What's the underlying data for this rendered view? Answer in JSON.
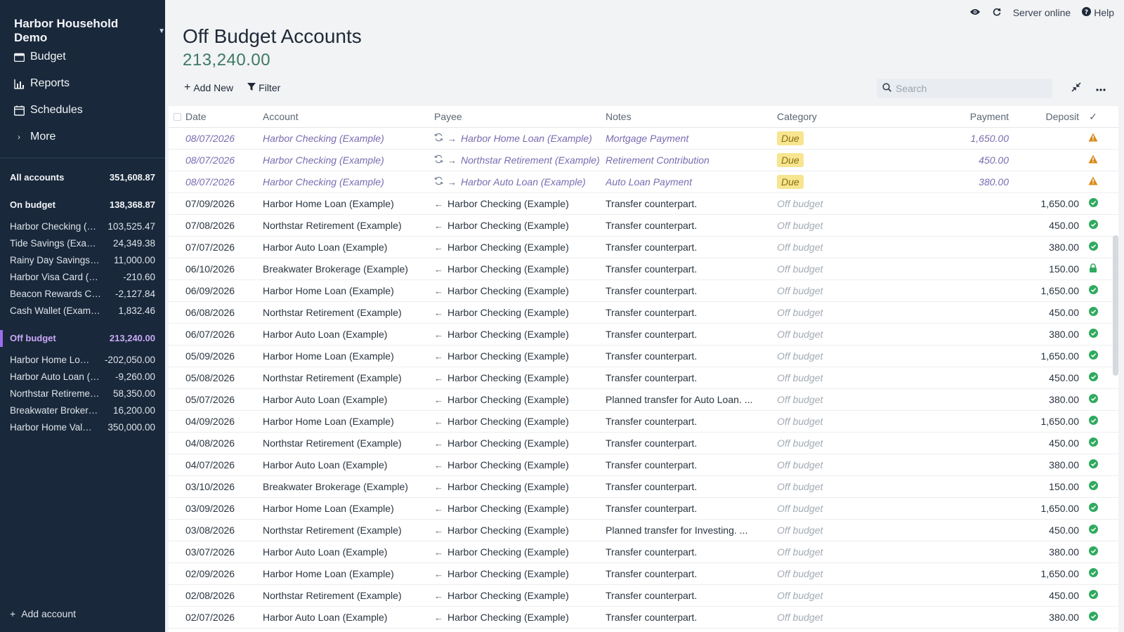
{
  "sidebar": {
    "budget_name": "Harbor Household Demo",
    "nav": [
      {
        "label": "Budget",
        "icon": "wallet-icon"
      },
      {
        "label": "Reports",
        "icon": "bar-chart-icon"
      },
      {
        "label": "Schedules",
        "icon": "calendar-icon"
      },
      {
        "label": "More",
        "icon": "chevron-right-icon"
      }
    ],
    "all_accounts": {
      "label": "All accounts",
      "balance": "351,608.87"
    },
    "on_budget": {
      "label": "On budget",
      "balance": "138,368.87"
    },
    "on_budget_accounts": [
      {
        "name": "Harbor Checking (Example)",
        "balance": "103,525.47"
      },
      {
        "name": "Tide Savings (Example)",
        "balance": "24,349.38"
      },
      {
        "name": "Rainy Day Savings (Example)",
        "balance": "11,000.00"
      },
      {
        "name": "Harbor Visa Card (Example)",
        "balance": "-210.60"
      },
      {
        "name": "Beacon Rewards Card (Example)",
        "balance": "-2,127.84"
      },
      {
        "name": "Cash Wallet (Example)",
        "balance": "1,832.46"
      }
    ],
    "off_budget": {
      "label": "Off budget",
      "balance": "213,240.00"
    },
    "off_budget_accounts": [
      {
        "name": "Harbor Home Loan (Example)",
        "balance": "-202,050.00"
      },
      {
        "name": "Harbor Auto Loan (Example)",
        "balance": "-9,260.00"
      },
      {
        "name": "Northstar Retirement (Example)",
        "balance": "58,350.00"
      },
      {
        "name": "Breakwater Brokerage (Example)",
        "balance": "16,200.00"
      },
      {
        "name": "Harbor Home Value (Example)",
        "balance": "350,000.00"
      }
    ],
    "add_account": "Add account"
  },
  "topbar": {
    "server_status": "Server online",
    "help": "Help"
  },
  "header": {
    "title": "Off Budget Accounts",
    "balance": "213,240.00"
  },
  "toolbar": {
    "add_new": "Add New",
    "filter": "Filter",
    "search_placeholder": "Search"
  },
  "table": {
    "columns": {
      "date": "Date",
      "account": "Account",
      "payee": "Payee",
      "notes": "Notes",
      "category": "Category",
      "payment": "Payment",
      "deposit": "Deposit",
      "cleared": "✓"
    },
    "rows": [
      {
        "date": "08/07/2026",
        "account": "Harbor Checking (Example)",
        "payee": "Harbor Home Loan (Example)",
        "notes": "Mortgage Payment",
        "category": "Due",
        "payment": "1,650.00",
        "deposit": "",
        "status": "warning",
        "scheduled": true
      },
      {
        "date": "08/07/2026",
        "account": "Harbor Checking (Example)",
        "payee": "Northstar Retirement (Example)",
        "notes": "Retirement Contribution",
        "category": "Due",
        "payment": "450.00",
        "deposit": "",
        "status": "warning",
        "scheduled": true
      },
      {
        "date": "08/07/2026",
        "account": "Harbor Checking (Example)",
        "payee": "Harbor Auto Loan (Example)",
        "notes": "Auto Loan Payment",
        "category": "Due",
        "payment": "380.00",
        "deposit": "",
        "status": "warning",
        "scheduled": true
      },
      {
        "date": "07/09/2026",
        "account": "Harbor Home Loan (Example)",
        "payee": "Harbor Checking (Example)",
        "notes": "Transfer counterpart.",
        "category": "Off budget",
        "payment": "",
        "deposit": "1,650.00",
        "status": "cleared",
        "scheduled": false
      },
      {
        "date": "07/08/2026",
        "account": "Northstar Retirement (Example)",
        "payee": "Harbor Checking (Example)",
        "notes": "Transfer counterpart.",
        "category": "Off budget",
        "payment": "",
        "deposit": "450.00",
        "status": "cleared",
        "scheduled": false
      },
      {
        "date": "07/07/2026",
        "account": "Harbor Auto Loan (Example)",
        "payee": "Harbor Checking (Example)",
        "notes": "Transfer counterpart.",
        "category": "Off budget",
        "payment": "",
        "deposit": "380.00",
        "status": "cleared",
        "scheduled": false
      },
      {
        "date": "06/10/2026",
        "account": "Breakwater Brokerage (Example)",
        "payee": "Harbor Checking (Example)",
        "notes": "Transfer counterpart.",
        "category": "Off budget",
        "payment": "",
        "deposit": "150.00",
        "status": "locked",
        "scheduled": false
      },
      {
        "date": "06/09/2026",
        "account": "Harbor Home Loan (Example)",
        "payee": "Harbor Checking (Example)",
        "notes": "Transfer counterpart.",
        "category": "Off budget",
        "payment": "",
        "deposit": "1,650.00",
        "status": "cleared",
        "scheduled": false
      },
      {
        "date": "06/08/2026",
        "account": "Northstar Retirement (Example)",
        "payee": "Harbor Checking (Example)",
        "notes": "Transfer counterpart.",
        "category": "Off budget",
        "payment": "",
        "deposit": "450.00",
        "status": "cleared",
        "scheduled": false
      },
      {
        "date": "06/07/2026",
        "account": "Harbor Auto Loan (Example)",
        "payee": "Harbor Checking (Example)",
        "notes": "Transfer counterpart.",
        "category": "Off budget",
        "payment": "",
        "deposit": "380.00",
        "status": "cleared",
        "scheduled": false
      },
      {
        "date": "05/09/2026",
        "account": "Harbor Home Loan (Example)",
        "payee": "Harbor Checking (Example)",
        "notes": "Transfer counterpart.",
        "category": "Off budget",
        "payment": "",
        "deposit": "1,650.00",
        "status": "cleared",
        "scheduled": false
      },
      {
        "date": "05/08/2026",
        "account": "Northstar Retirement (Example)",
        "payee": "Harbor Checking (Example)",
        "notes": "Transfer counterpart.",
        "category": "Off budget",
        "payment": "",
        "deposit": "450.00",
        "status": "cleared",
        "scheduled": false
      },
      {
        "date": "05/07/2026",
        "account": "Harbor Auto Loan (Example)",
        "payee": "Harbor Checking (Example)",
        "notes": "Planned transfer for Auto Loan. ...",
        "category": "Off budget",
        "payment": "",
        "deposit": "380.00",
        "status": "cleared",
        "scheduled": false
      },
      {
        "date": "04/09/2026",
        "account": "Harbor Home Loan (Example)",
        "payee": "Harbor Checking (Example)",
        "notes": "Transfer counterpart.",
        "category": "Off budget",
        "payment": "",
        "deposit": "1,650.00",
        "status": "cleared",
        "scheduled": false
      },
      {
        "date": "04/08/2026",
        "account": "Northstar Retirement (Example)",
        "payee": "Harbor Checking (Example)",
        "notes": "Transfer counterpart.",
        "category": "Off budget",
        "payment": "",
        "deposit": "450.00",
        "status": "cleared",
        "scheduled": false
      },
      {
        "date": "04/07/2026",
        "account": "Harbor Auto Loan (Example)",
        "payee": "Harbor Checking (Example)",
        "notes": "Transfer counterpart.",
        "category": "Off budget",
        "payment": "",
        "deposit": "380.00",
        "status": "cleared",
        "scheduled": false
      },
      {
        "date": "03/10/2026",
        "account": "Breakwater Brokerage (Example)",
        "payee": "Harbor Checking (Example)",
        "notes": "Transfer counterpart.",
        "category": "Off budget",
        "payment": "",
        "deposit": "150.00",
        "status": "cleared",
        "scheduled": false
      },
      {
        "date": "03/09/2026",
        "account": "Harbor Home Loan (Example)",
        "payee": "Harbor Checking (Example)",
        "notes": "Transfer counterpart.",
        "category": "Off budget",
        "payment": "",
        "deposit": "1,650.00",
        "status": "cleared",
        "scheduled": false
      },
      {
        "date": "03/08/2026",
        "account": "Northstar Retirement (Example)",
        "payee": "Harbor Checking (Example)",
        "notes": "Planned transfer for Investing. ...",
        "category": "Off budget",
        "payment": "",
        "deposit": "450.00",
        "status": "cleared",
        "scheduled": false
      },
      {
        "date": "03/07/2026",
        "account": "Harbor Auto Loan (Example)",
        "payee": "Harbor Checking (Example)",
        "notes": "Transfer counterpart.",
        "category": "Off budget",
        "payment": "",
        "deposit": "380.00",
        "status": "cleared",
        "scheduled": false
      },
      {
        "date": "02/09/2026",
        "account": "Harbor Home Loan (Example)",
        "payee": "Harbor Checking (Example)",
        "notes": "Transfer counterpart.",
        "category": "Off budget",
        "payment": "",
        "deposit": "1,650.00",
        "status": "cleared",
        "scheduled": false
      },
      {
        "date": "02/08/2026",
        "account": "Northstar Retirement (Example)",
        "payee": "Harbor Checking (Example)",
        "notes": "Transfer counterpart.",
        "category": "Off budget",
        "payment": "",
        "deposit": "450.00",
        "status": "cleared",
        "scheduled": false
      },
      {
        "date": "02/07/2026",
        "account": "Harbor Auto Loan (Example)",
        "payee": "Harbor Checking (Example)",
        "notes": "Transfer counterpart.",
        "category": "Off budget",
        "payment": "",
        "deposit": "380.00",
        "status": "cleared",
        "scheduled": false
      }
    ]
  },
  "colors": {
    "sidebar_bg": "#19283b",
    "off_budget_accent": "#9b6cf0",
    "balance_green": "#3d7a62",
    "due_badge": "#f7e58f",
    "cleared_green": "#2faa5f",
    "warning_orange": "#d98a1a"
  }
}
